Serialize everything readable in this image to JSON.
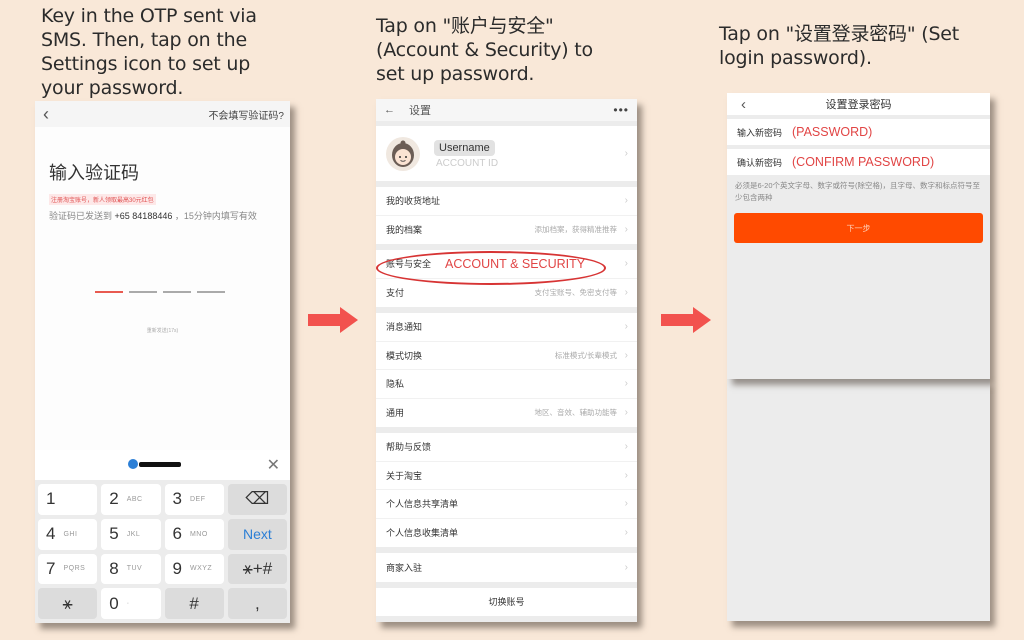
{
  "captions": {
    "step1": "Key in the OTP sent via SMS. Then, tap on the Settings icon to set up your password.",
    "step2": "Tap on \"账户与安全\" (Account & Security) to set up password.",
    "step3": "Tap on \"设置登录密码\" (Set login password)."
  },
  "colors": {
    "accent_red": "#e14545",
    "button_orange": "#ff4a00",
    "link_blue": "#2c7fd6",
    "background": "#f9e8d8"
  },
  "otp_screen": {
    "back_icon": "chevron-left-icon",
    "help_link": "不会填写验证码?",
    "title": "输入验证码",
    "promo": "注册淘宝账号，新人领取最高30元红包",
    "sent_prefix": "验证码已发送到",
    "phone_number": "+65 84188446",
    "sent_suffix": "，15分钟内填写有效",
    "otp_slots": 4,
    "resend": "重新发送(17s)",
    "keyboard": {
      "close_icon": "close-icon",
      "keys": [
        {
          "main": "1",
          "sub": ""
        },
        {
          "main": "2",
          "sub": "ABC"
        },
        {
          "main": "3",
          "sub": "DEF"
        },
        {
          "main": "⌫",
          "sub": "",
          "fn": true
        },
        {
          "main": "4",
          "sub": "GHI"
        },
        {
          "main": "5",
          "sub": "JKL"
        },
        {
          "main": "6",
          "sub": "MNO"
        },
        {
          "main": "Next",
          "sub": "",
          "fn": true
        },
        {
          "main": "7",
          "sub": "PQRS"
        },
        {
          "main": "8",
          "sub": "TUV"
        },
        {
          "main": "9",
          "sub": "WXYZ"
        },
        {
          "main": "⚹+#",
          "sub": "",
          "fn": true
        },
        {
          "main": "⚹",
          "sub": "",
          "fn": true
        },
        {
          "main": "0",
          "sub": "·"
        },
        {
          "main": "#",
          "sub": "",
          "fn": true
        },
        {
          "main": ",",
          "sub": "",
          "fn": true
        }
      ]
    }
  },
  "settings_screen": {
    "title": "设置",
    "more_icon": "•••",
    "profile": {
      "username": "Username",
      "account_id": "ACCOUNT ID"
    },
    "groups": [
      [
        {
          "label": "我的收货地址",
          "hint": ""
        },
        {
          "label": "我的档案",
          "hint": "添加档案，获得精准推荐"
        }
      ],
      [
        {
          "label": "账号与安全",
          "hint": "",
          "annotation": "ACCOUNT & SECURITY",
          "highlighted": true
        },
        {
          "label": "支付",
          "hint": "支付宝账号、免密支付等"
        }
      ],
      [
        {
          "label": "消息通知",
          "hint": ""
        },
        {
          "label": "模式切换",
          "hint": "标准模式/长辈模式"
        },
        {
          "label": "隐私",
          "hint": ""
        },
        {
          "label": "通用",
          "hint": "地区、音效、辅助功能等"
        }
      ],
      [
        {
          "label": "帮助与反馈",
          "hint": ""
        },
        {
          "label": "关于淘宝",
          "hint": ""
        },
        {
          "label": "个人信息共享清单",
          "hint": ""
        },
        {
          "label": "个人信息收集清单",
          "hint": ""
        }
      ],
      [
        {
          "label": "商家入驻",
          "hint": ""
        }
      ]
    ],
    "switch_account": "切换账号"
  },
  "password_screen": {
    "title": "设置登录密码",
    "new_password_label": "输入新密码",
    "new_password_placeholder": "(PASSWORD)",
    "confirm_label": "确认新密码",
    "confirm_placeholder": "(CONFIRM PASSWORD)",
    "rule": "必须是6-20个英文字母、数字或符号(除空格)，且字母、数字和标点符号至少包含两种",
    "next_button": "下一步"
  }
}
